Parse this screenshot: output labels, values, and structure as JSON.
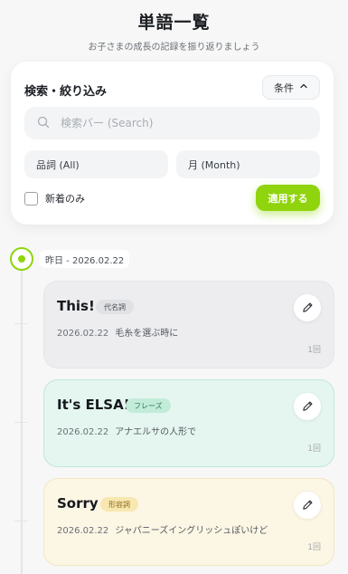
{
  "page": {
    "title": "単語一覧",
    "subtitle": "お子さまの成長の記録を振り返りましょう"
  },
  "filter": {
    "title": "検索・絞り込み",
    "condition_button": "条件",
    "search_placeholder": "検索バー (Search)",
    "part_of_speech_select": "品詞 (All)",
    "month_select": "月 (Month)",
    "new_only_label": "新着のみ",
    "new_only_checked": false,
    "apply_button": "適用する",
    "accent_color": "#8fd40c"
  },
  "timeline": {
    "group_date": "昨日 - 2026.02.22",
    "entries": [
      {
        "word": "This!",
        "pos": "代名詞",
        "date": "2026.02.22",
        "note": "毛糸を選ぶ時に",
        "count": "1回",
        "card_color": "#ededef",
        "badge_bg": "#e0e1e4",
        "badge_fg": "#4a4f56"
      },
      {
        "word": "It's ELSA!",
        "pos": "フレーズ",
        "date": "2026.02.22",
        "note": "アナエルサの人形で",
        "count": "1回",
        "card_color": "#e5f6f0",
        "badge_bg": "#c2ecd9",
        "badge_fg": "#2c7a58"
      },
      {
        "word": "Sorry",
        "pos": "形容詞",
        "date": "2026.02.22",
        "note": "ジャパニーズイングリッシュぽいけど",
        "count": "1回",
        "card_color": "#fcf6e4",
        "badge_bg": "#f8e7b0",
        "badge_fg": "#8a6a14"
      }
    ]
  },
  "icons": {
    "condition": "chevron-up-icon",
    "search": "search-icon",
    "edit": "pencil-icon"
  }
}
